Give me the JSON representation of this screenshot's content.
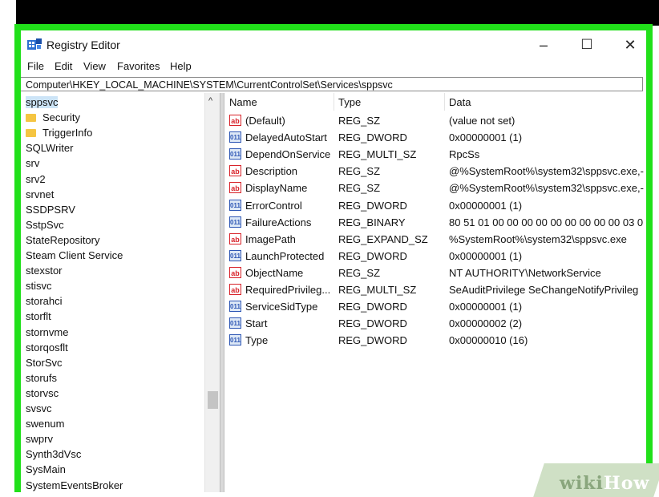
{
  "window": {
    "title": "Registry Editor",
    "minimize_glyph": "–",
    "maximize_glyph": "☐",
    "close_glyph": "✕"
  },
  "menu": [
    "File",
    "Edit",
    "View",
    "Favorites",
    "Help"
  ],
  "address": "Computer\\HKEY_LOCAL_MACHINE\\SYSTEM\\CurrentControlSet\\Services\\sppsvc",
  "tree": {
    "items": [
      {
        "label": "sppsvc",
        "selected": true,
        "folder": false,
        "indent": 0
      },
      {
        "label": "Security",
        "selected": false,
        "folder": true,
        "indent": 1
      },
      {
        "label": "TriggerInfo",
        "selected": false,
        "folder": true,
        "indent": 1
      },
      {
        "label": "SQLWriter",
        "folder": false,
        "indent": 0
      },
      {
        "label": "srv",
        "folder": false,
        "indent": 0
      },
      {
        "label": "srv2",
        "folder": false,
        "indent": 0
      },
      {
        "label": "srvnet",
        "folder": false,
        "indent": 0
      },
      {
        "label": "SSDPSRV",
        "folder": false,
        "indent": 0
      },
      {
        "label": "SstpSvc",
        "folder": false,
        "indent": 0
      },
      {
        "label": "StateRepository",
        "folder": false,
        "indent": 0
      },
      {
        "label": "Steam Client Service",
        "folder": false,
        "indent": 0
      },
      {
        "label": "stexstor",
        "folder": false,
        "indent": 0
      },
      {
        "label": "stisvc",
        "folder": false,
        "indent": 0
      },
      {
        "label": "storahci",
        "folder": false,
        "indent": 0
      },
      {
        "label": "storflt",
        "folder": false,
        "indent": 0
      },
      {
        "label": "stornvme",
        "folder": false,
        "indent": 0
      },
      {
        "label": "storqosflt",
        "folder": false,
        "indent": 0
      },
      {
        "label": "StorSvc",
        "folder": false,
        "indent": 0
      },
      {
        "label": "storufs",
        "folder": false,
        "indent": 0
      },
      {
        "label": "storvsc",
        "folder": false,
        "indent": 0
      },
      {
        "label": "svsvc",
        "folder": false,
        "indent": 0
      },
      {
        "label": "swenum",
        "folder": false,
        "indent": 0
      },
      {
        "label": "swprv",
        "folder": false,
        "indent": 0
      },
      {
        "label": "Synth3dVsc",
        "folder": false,
        "indent": 0
      },
      {
        "label": "SysMain",
        "folder": false,
        "indent": 0
      },
      {
        "label": "SystemEventsBroker",
        "folder": false,
        "indent": 0
      }
    ]
  },
  "columns": {
    "name": "Name",
    "type": "Type",
    "data": "Data"
  },
  "values": [
    {
      "icon": "sz",
      "name": "(Default)",
      "type": "REG_SZ",
      "data": "(value not set)"
    },
    {
      "icon": "bin",
      "name": "DelayedAutoStart",
      "type": "REG_DWORD",
      "data": "0x00000001 (1)"
    },
    {
      "icon": "bin",
      "name": "DependOnService",
      "type": "REG_MULTI_SZ",
      "data": "RpcSs"
    },
    {
      "icon": "sz",
      "name": "Description",
      "type": "REG_SZ",
      "data": "@%SystemRoot%\\system32\\sppsvc.exe,-"
    },
    {
      "icon": "sz",
      "name": "DisplayName",
      "type": "REG_SZ",
      "data": "@%SystemRoot%\\system32\\sppsvc.exe,-"
    },
    {
      "icon": "bin",
      "name": "ErrorControl",
      "type": "REG_DWORD",
      "data": "0x00000001 (1)"
    },
    {
      "icon": "bin",
      "name": "FailureActions",
      "type": "REG_BINARY",
      "data": "80 51 01 00 00 00 00 00 00 00 00 00 03 0"
    },
    {
      "icon": "sz",
      "name": "ImagePath",
      "type": "REG_EXPAND_SZ",
      "data": "%SystemRoot%\\system32\\sppsvc.exe"
    },
    {
      "icon": "bin",
      "name": "LaunchProtected",
      "type": "REG_DWORD",
      "data": "0x00000001 (1)"
    },
    {
      "icon": "sz",
      "name": "ObjectName",
      "type": "REG_SZ",
      "data": "NT AUTHORITY\\NetworkService"
    },
    {
      "icon": "sz",
      "name": "RequiredPrivileg...",
      "type": "REG_MULTI_SZ",
      "data": "SeAuditPrivilege SeChangeNotifyPrivileg"
    },
    {
      "icon": "bin",
      "name": "ServiceSidType",
      "type": "REG_DWORD",
      "data": "0x00000001 (1)"
    },
    {
      "icon": "bin",
      "name": "Start",
      "type": "REG_DWORD",
      "data": "0x00000002 (2)"
    },
    {
      "icon": "bin",
      "name": "Type",
      "type": "REG_DWORD",
      "data": "0x00000010 (16)"
    }
  ],
  "icon_text": {
    "sz": "ab",
    "bin": "011"
  },
  "watermark": {
    "part1": "wiki",
    "part2": "How"
  },
  "colors": {
    "frame": "#21e01a",
    "selection": "#cce4f7"
  }
}
